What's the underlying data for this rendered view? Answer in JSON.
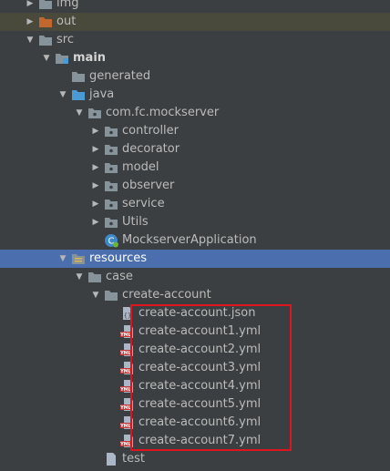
{
  "tree": {
    "rows": [
      {
        "label": "img",
        "depth": 1,
        "arrow": "right",
        "icon": "folder-icon",
        "bold": false,
        "state": ""
      },
      {
        "label": "out",
        "depth": 1,
        "arrow": "right",
        "icon": "folder-orange-icon",
        "bold": false,
        "state": "excluded"
      },
      {
        "label": "src",
        "depth": 1,
        "arrow": "down",
        "icon": "folder-icon",
        "bold": false,
        "state": ""
      },
      {
        "label": "main",
        "depth": 2,
        "arrow": "down",
        "icon": "module-folder-icon",
        "bold": true,
        "state": ""
      },
      {
        "label": "generated",
        "depth": 3,
        "arrow": "none",
        "icon": "folder-icon",
        "bold": false,
        "state": ""
      },
      {
        "label": "java",
        "depth": 3,
        "arrow": "down",
        "icon": "source-folder-icon",
        "bold": false,
        "state": ""
      },
      {
        "label": "com.fc.mockserver",
        "depth": 4,
        "arrow": "down",
        "icon": "package-icon",
        "bold": false,
        "state": ""
      },
      {
        "label": "controller",
        "depth": 5,
        "arrow": "right",
        "icon": "package-icon",
        "bold": false,
        "state": ""
      },
      {
        "label": "decorator",
        "depth": 5,
        "arrow": "right",
        "icon": "package-icon",
        "bold": false,
        "state": ""
      },
      {
        "label": "model",
        "depth": 5,
        "arrow": "right",
        "icon": "package-icon",
        "bold": false,
        "state": ""
      },
      {
        "label": "observer",
        "depth": 5,
        "arrow": "right",
        "icon": "package-icon",
        "bold": false,
        "state": ""
      },
      {
        "label": "service",
        "depth": 5,
        "arrow": "right",
        "icon": "package-icon",
        "bold": false,
        "state": ""
      },
      {
        "label": "Utils",
        "depth": 5,
        "arrow": "right",
        "icon": "package-icon",
        "bold": false,
        "state": ""
      },
      {
        "label": "MockserverApplication",
        "depth": 5,
        "arrow": "none",
        "icon": "spring-class-icon",
        "bold": false,
        "state": ""
      },
      {
        "label": "resources",
        "depth": 3,
        "arrow": "down",
        "icon": "resources-folder-icon",
        "bold": false,
        "state": "selected"
      },
      {
        "label": "case",
        "depth": 4,
        "arrow": "down",
        "icon": "folder-icon",
        "bold": false,
        "state": ""
      },
      {
        "label": "create-account",
        "depth": 5,
        "arrow": "down",
        "icon": "folder-icon",
        "bold": false,
        "state": ""
      },
      {
        "label": "create-account.json",
        "depth": 6,
        "arrow": "none",
        "icon": "json-file-icon",
        "bold": false,
        "state": ""
      },
      {
        "label": "create-account1.yml",
        "depth": 6,
        "arrow": "none",
        "icon": "yml-file-icon",
        "bold": false,
        "state": ""
      },
      {
        "label": "create-account2.yml",
        "depth": 6,
        "arrow": "none",
        "icon": "yml-file-icon",
        "bold": false,
        "state": ""
      },
      {
        "label": "create-account3.yml",
        "depth": 6,
        "arrow": "none",
        "icon": "yml-file-icon",
        "bold": false,
        "state": ""
      },
      {
        "label": "create-account4.yml",
        "depth": 6,
        "arrow": "none",
        "icon": "yml-file-icon",
        "bold": false,
        "state": ""
      },
      {
        "label": "create-account5.yml",
        "depth": 6,
        "arrow": "none",
        "icon": "yml-file-icon",
        "bold": false,
        "state": ""
      },
      {
        "label": "create-account6.yml",
        "depth": 6,
        "arrow": "none",
        "icon": "yml-file-icon",
        "bold": false,
        "state": ""
      },
      {
        "label": "create-account7.yml",
        "depth": 6,
        "arrow": "none",
        "icon": "yml-file-icon",
        "bold": false,
        "state": ""
      },
      {
        "label": "test",
        "depth": 5,
        "arrow": "none",
        "icon": "file-icon",
        "bold": false,
        "state": ""
      }
    ]
  },
  "colors": {
    "background": "#3c3f41",
    "selection": "#4b6eaf",
    "highlight_border": "#e0141e",
    "folder": "#87939a",
    "folder_orange": "#c2682e",
    "source_folder": "#4a9bd4",
    "yml_badge": "#c03a3a"
  }
}
